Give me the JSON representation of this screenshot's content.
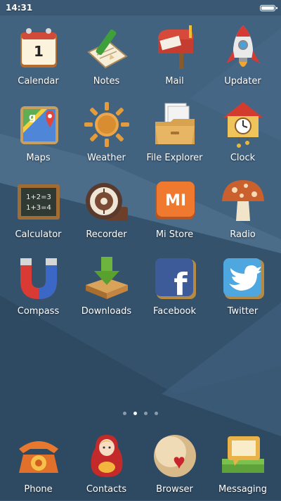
{
  "status_bar": {
    "time": "14:31"
  },
  "apps": [
    {
      "label": "Calendar",
      "icon": "calendar-icon",
      "calendar_day": "1"
    },
    {
      "label": "Notes",
      "icon": "notes-icon"
    },
    {
      "label": "Mail",
      "icon": "mailbox-icon"
    },
    {
      "label": "Updater",
      "icon": "rocket-icon"
    },
    {
      "label": "Maps",
      "icon": "maps-icon",
      "map_letter": "g"
    },
    {
      "label": "Weather",
      "icon": "sun-icon"
    },
    {
      "label": "File Explorer",
      "icon": "folder-icon"
    },
    {
      "label": "Clock",
      "icon": "cuckoo-clock-icon"
    },
    {
      "label": "Calculator",
      "icon": "chalkboard-icon",
      "chalk_line1": "1+2=3",
      "chalk_line2": "1+3=4"
    },
    {
      "label": "Recorder",
      "icon": "tape-recorder-icon"
    },
    {
      "label": "Mi Store",
      "icon": "mi-store-icon",
      "brand_text": "MI"
    },
    {
      "label": "Radio",
      "icon": "mushroom-icon"
    },
    {
      "label": "Compass",
      "icon": "magnet-icon"
    },
    {
      "label": "Downloads",
      "icon": "download-arrow-icon"
    },
    {
      "label": "Facebook",
      "icon": "facebook-icon",
      "brand_letter": "f"
    },
    {
      "label": "Twitter",
      "icon": "twitter-bird-icon"
    }
  ],
  "page_indicator": {
    "total": 4,
    "current": 2
  },
  "dock": [
    {
      "label": "Phone",
      "icon": "rotary-phone-icon"
    },
    {
      "label": "Contacts",
      "icon": "matryoshka-icon"
    },
    {
      "label": "Browser",
      "icon": "globe-heart-icon"
    },
    {
      "label": "Messaging",
      "icon": "message-bubbles-icon"
    }
  ],
  "colors": {
    "wallpaper_base": "#3a5873",
    "wallpaper_light": "#4b6d8a",
    "wallpaper_dark": "#2e4a63"
  }
}
